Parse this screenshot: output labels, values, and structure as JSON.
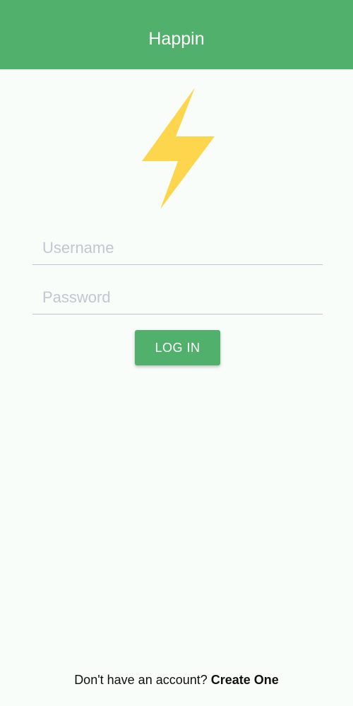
{
  "header": {
    "title": "Happin",
    "background_color": "#52b06d"
  },
  "logo": {
    "icon": "lightning-bolt-icon",
    "color": "#fed64d"
  },
  "form": {
    "username_placeholder": "Username",
    "username_value": "",
    "password_placeholder": "Password",
    "password_value": "",
    "login_label": "LOG IN"
  },
  "footer": {
    "prompt_text": "Don't have an account? ",
    "create_link_label": "Create One"
  },
  "colors": {
    "accent": "#52b06d",
    "background": "#f8fdf9",
    "logo": "#fed64d"
  }
}
